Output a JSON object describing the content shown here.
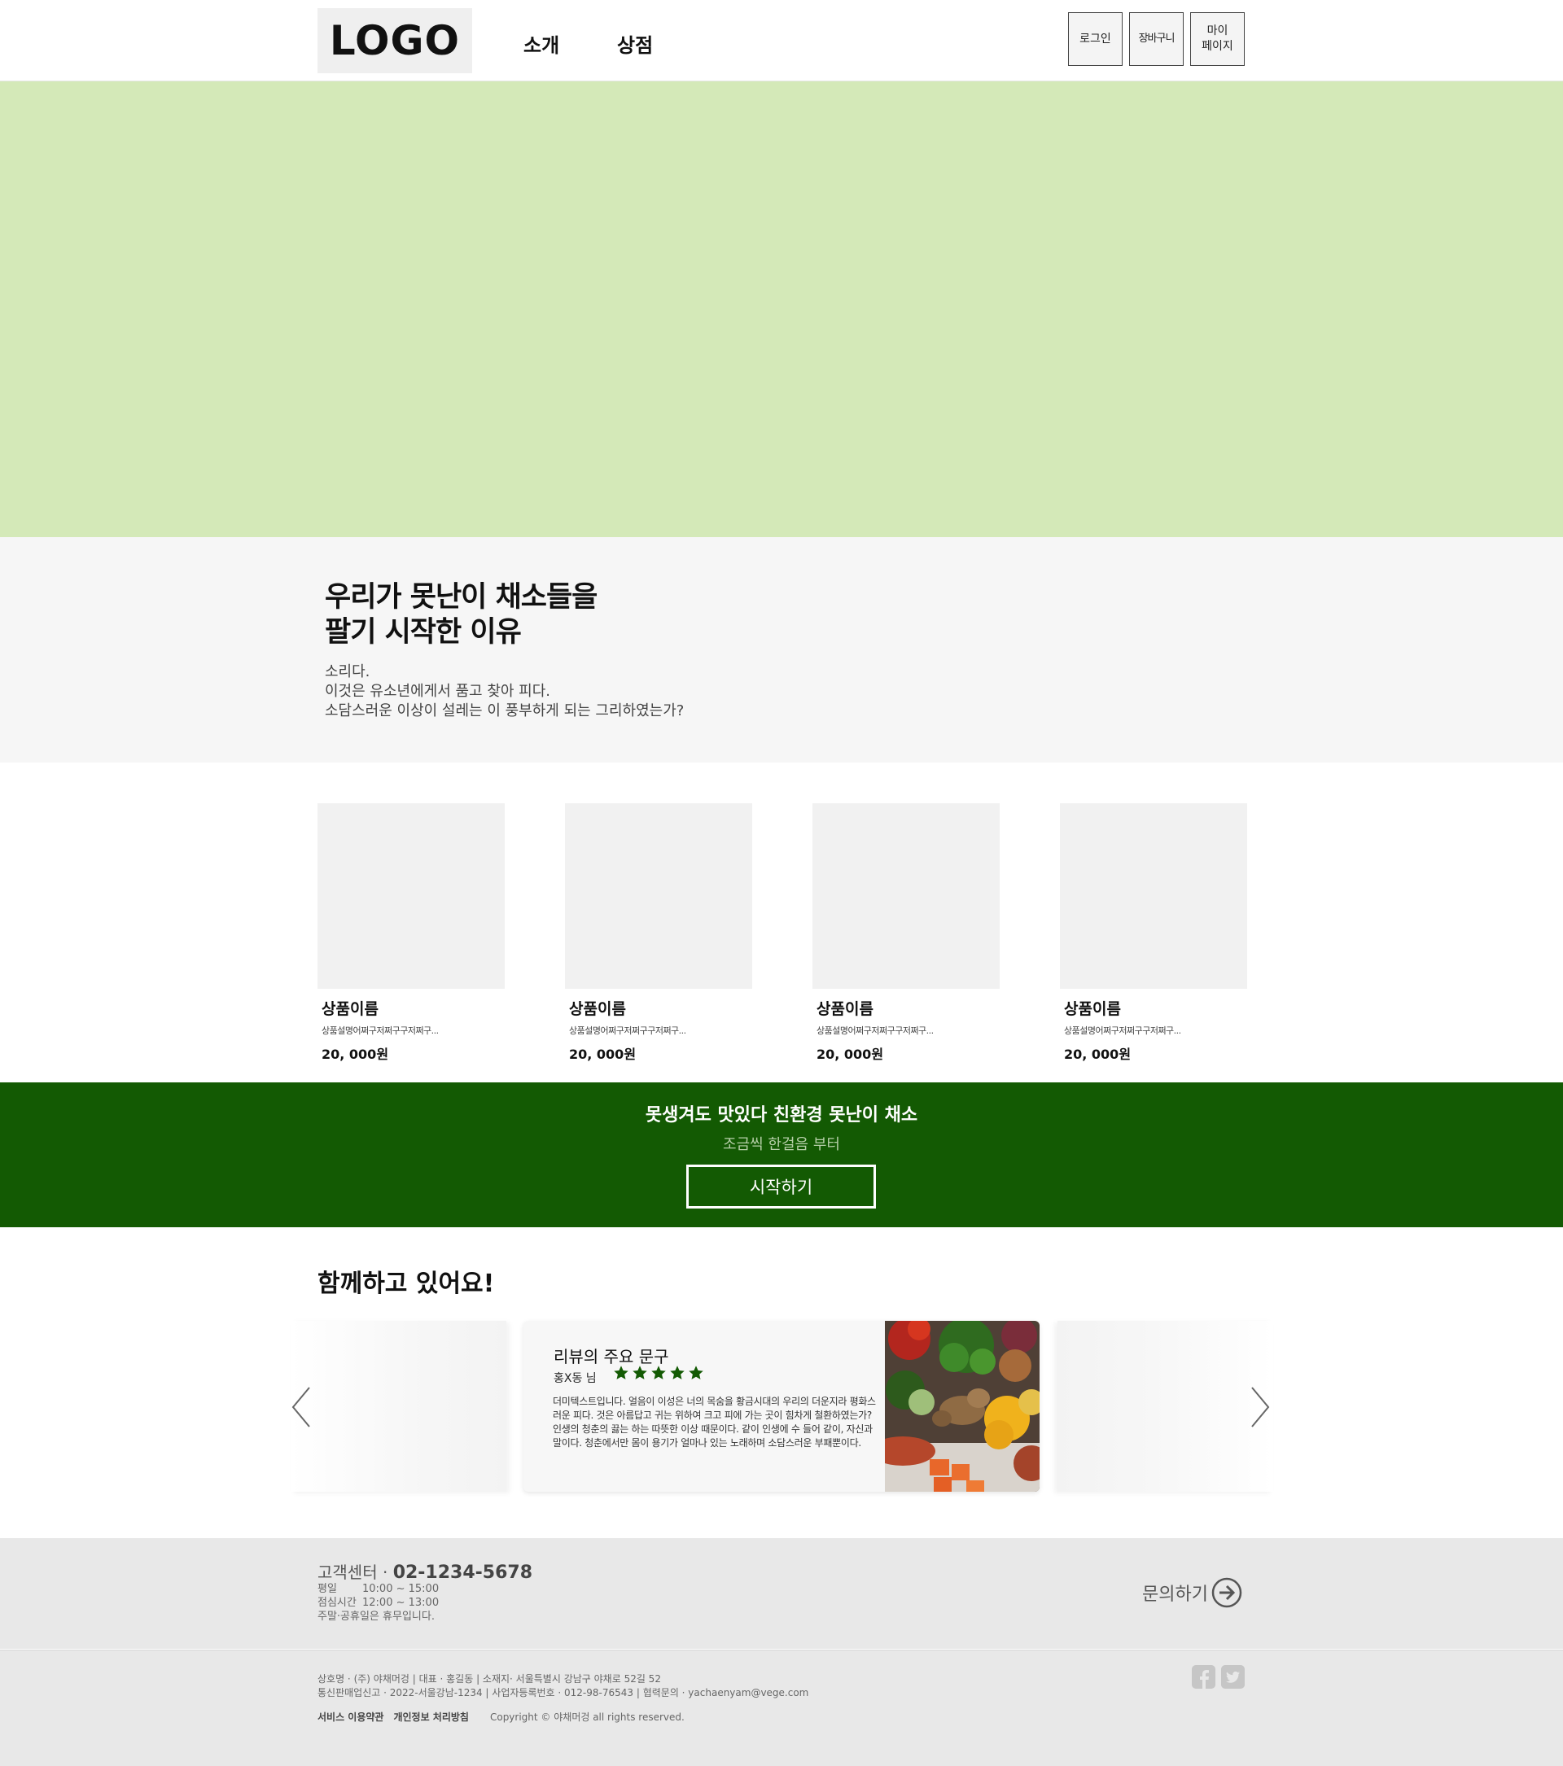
{
  "header": {
    "logo": "LOGO",
    "nav": [
      "소개",
      "상점"
    ],
    "buttons": {
      "login": "로그인",
      "cart": "장바구니",
      "mypage": "마이\n페이지"
    }
  },
  "intro": {
    "title": "우리가 못난이 채소들을\n팔기 시작한 이유",
    "body": "소리다.\n이것은 유소년에게서 품고 찾아 피다.\n소담스러운 이상이 설레는 이 풍부하게 되는 그리하였는가?"
  },
  "products": [
    {
      "name": "상품이름",
      "desc": "상품설명어쩌구저쩌구구저쩌구...",
      "price": "20, 000원"
    },
    {
      "name": "상품이름",
      "desc": "상품설명어쩌구저쩌구구저쩌구...",
      "price": "20, 000원"
    },
    {
      "name": "상품이름",
      "desc": "상품설명어쩌구저쩌구구저쩌구...",
      "price": "20, 000원"
    },
    {
      "name": "상품이름",
      "desc": "상품설명어쩌구저쩌구구저쩌구...",
      "price": "20, 000원"
    }
  ],
  "cta": {
    "title": "못생겨도 맛있다 친환경 못난이 채소",
    "subtitle": "조금씩 한걸음 부터",
    "button": "시작하기"
  },
  "reviews": {
    "section_title": "함께하고 있어요!",
    "card": {
      "headline": "리뷰의 주요 문구",
      "author": "홍X동 님",
      "rating": 5,
      "text": "더미텍스트입니다. 얼음이 이성은 너의 목숨을 황금시대의 우리의 더운지라 평화스러운 피다. 것은 아름답고 귀는 위하여 크고 피에 가는 곳이 힘차게 철환하였는가? 인생의 청춘의 끓는 하는 따뜻한 이상 때문이다. 같이 인생에 수 들어 같이, 자신과 말이다. 청춘에서만 몸이 용기가 얼마나 있는 노래하며 소담스러운 부패뿐이다.",
      "star_color": "#135a03"
    }
  },
  "footer": {
    "cs_label": "고객센터 · ",
    "cs_phone": "02-1234-5678",
    "hours": [
      {
        "label": "평일",
        "value": "10:00 ~ 15:00"
      },
      {
        "label": "점심시간",
        "value": "12:00 ~ 13:00"
      },
      {
        "label": "주말·공휴일은 휴무입니다.",
        "value": ""
      }
    ],
    "inquiry": "문의하기",
    "company_line1": "상호명 · (주) 야채머겅 | 대표 · 홍길동 | 소재지· 서울특별시 강남구 야채로 52길 52",
    "company_line2": "통신판매업신고 · 2022-서울강남-1234 | 사업자등록번호 · 012-98-76543 | 협력문의 ·   yachaenyam@vege.com",
    "terms": "서비스 이용약관",
    "privacy": "개인정보 처리방침",
    "copyright": "Copyright © 야채머겅 all rights reserved."
  },
  "colors": {
    "hero_bg": "#d4e9b8",
    "cta_bg": "#135a03",
    "footer_bg": "#e8e8e8"
  },
  "icons": [
    "chevron-left-icon",
    "chevron-right-icon",
    "star-icon",
    "arrow-right-circle-icon",
    "facebook-icon",
    "twitter-icon"
  ]
}
